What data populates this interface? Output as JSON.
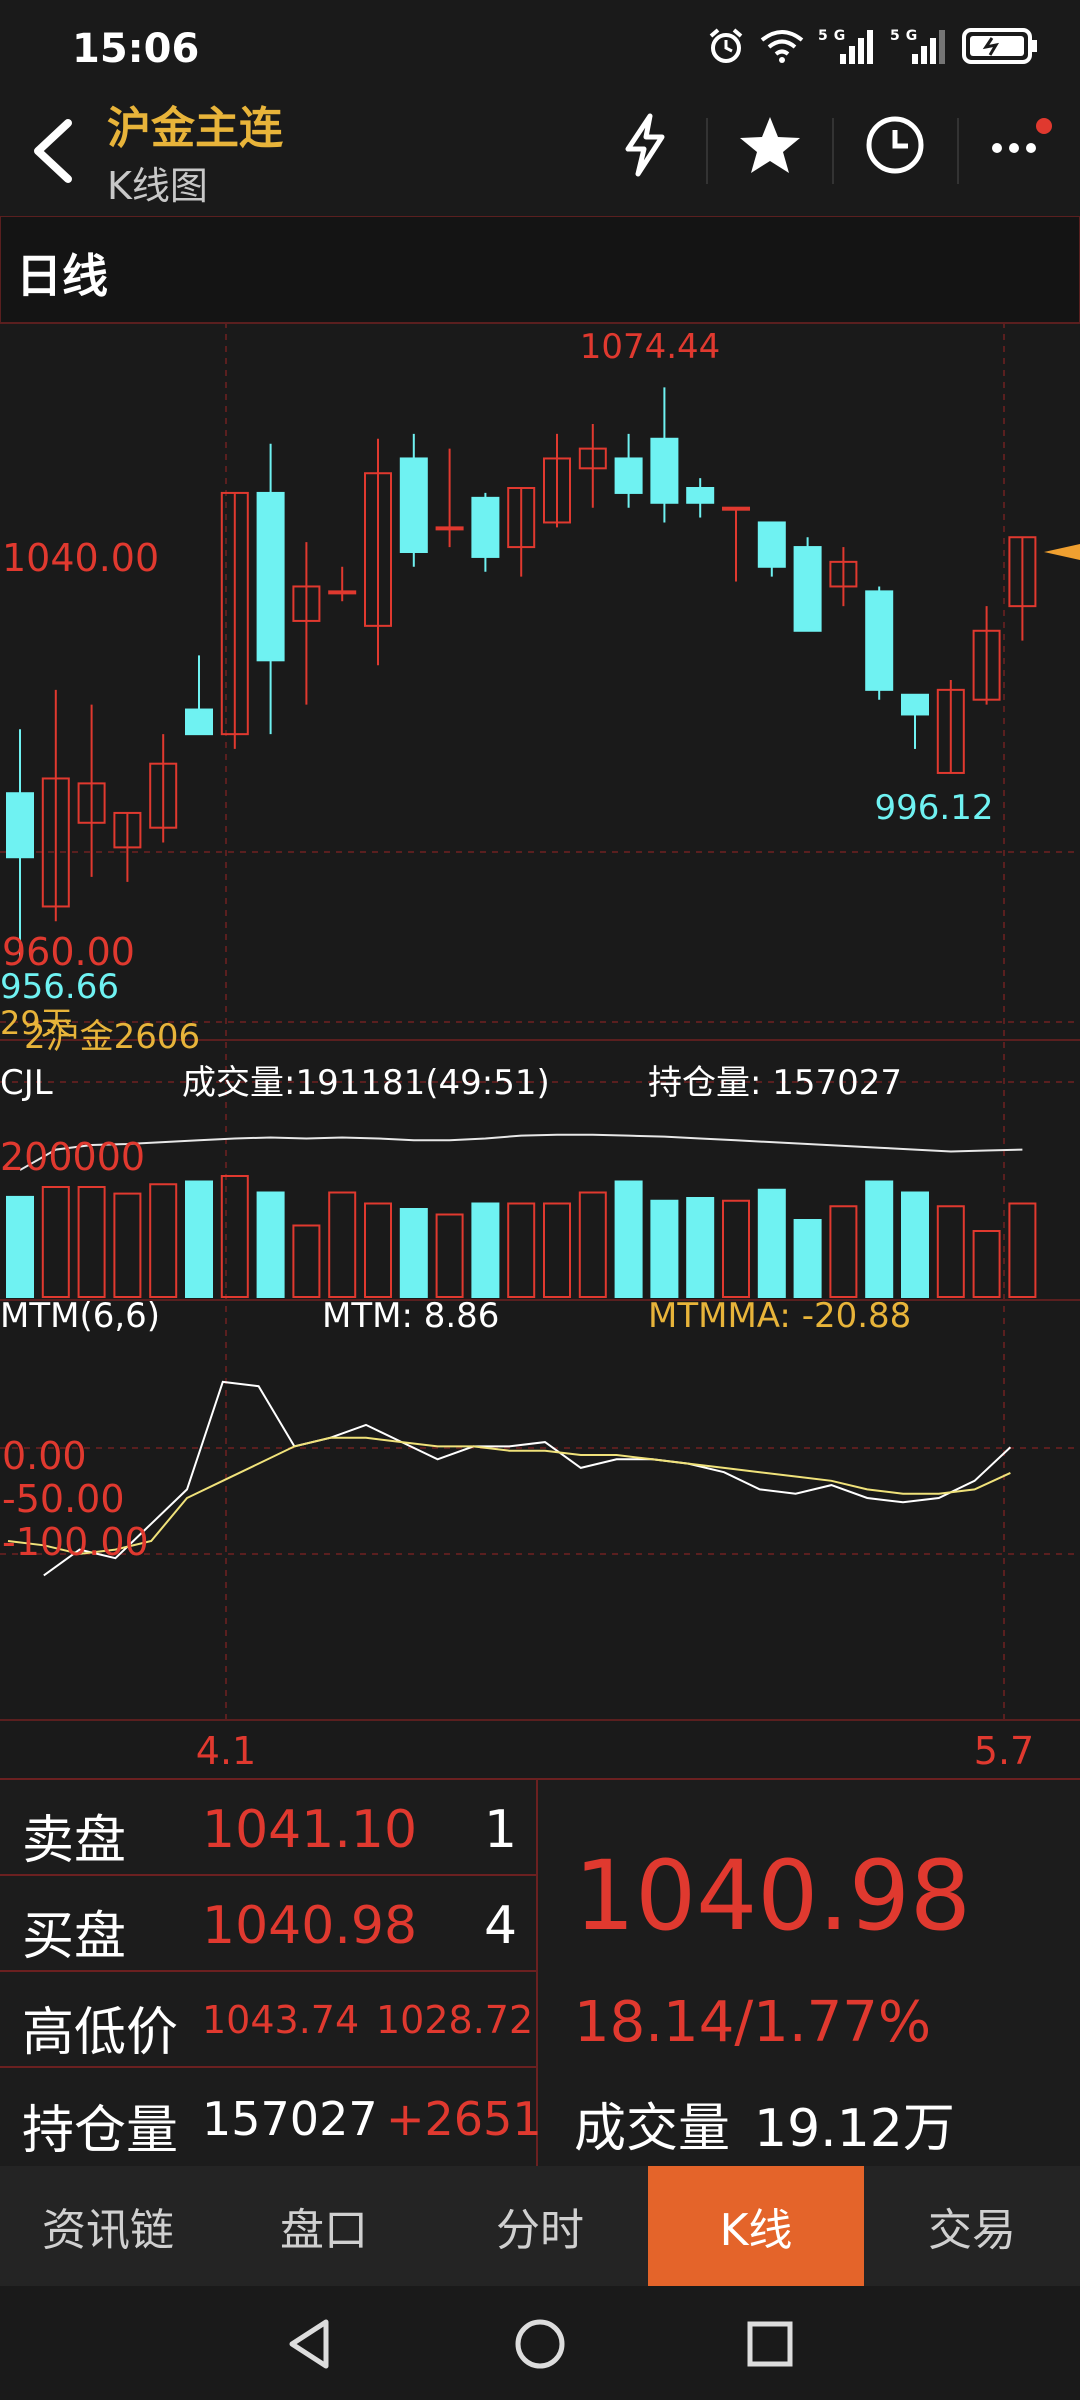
{
  "status": {
    "time": "15:06",
    "icons": [
      "alarm-icon",
      "wifi-icon",
      "5g-signal-icon",
      "5g-signal-icon",
      "battery-charging-icon"
    ]
  },
  "header": {
    "title": "沪金主连",
    "subtitle": "K线图",
    "actions": [
      "lightning-icon",
      "star-icon",
      "clock-icon",
      "more-icon"
    ]
  },
  "period": {
    "label": "日线"
  },
  "chart_data": {
    "type": "candlestick",
    "ylim": [
      950,
      1080
    ],
    "price_labels": [
      "1040.00",
      "960.00"
    ],
    "high_label": "1074.44",
    "low_label": "996.12",
    "left_low_label": "956.66",
    "contract_label": "2沪金2606",
    "contract_prefix": "29天",
    "x_ticks": [
      "4.1",
      "5.7"
    ],
    "candles": [
      {
        "o": 992,
        "h": 1005,
        "l": 958,
        "c": 979
      },
      {
        "o": 969,
        "h": 1013,
        "l": 966,
        "c": 995
      },
      {
        "o": 986,
        "h": 1010,
        "l": 975,
        "c": 994
      },
      {
        "o": 981,
        "h": 986,
        "l": 974,
        "c": 988
      },
      {
        "o": 985,
        "h": 1004,
        "l": 982,
        "c": 998
      },
      {
        "o": 1009,
        "h": 1020,
        "l": 1004,
        "c": 1004
      },
      {
        "o": 1004,
        "h": 1032,
        "l": 1001,
        "c": 1053
      },
      {
        "o": 1053,
        "h": 1063,
        "l": 1004,
        "c": 1019
      },
      {
        "o": 1027,
        "h": 1043,
        "l": 1010,
        "c": 1034
      },
      {
        "o": 1033,
        "h": 1038,
        "l": 1031,
        "c": 1033
      },
      {
        "o": 1026,
        "h": 1064,
        "l": 1018,
        "c": 1057
      },
      {
        "o": 1060,
        "h": 1065,
        "l": 1038,
        "c": 1041
      },
      {
        "o": 1046,
        "h": 1062,
        "l": 1042,
        "c": 1046
      },
      {
        "o": 1052,
        "h": 1053,
        "l": 1037,
        "c": 1040
      },
      {
        "o": 1042,
        "h": 1054,
        "l": 1036,
        "c": 1054
      },
      {
        "o": 1047,
        "h": 1065,
        "l": 1046,
        "c": 1060
      },
      {
        "o": 1058,
        "h": 1067,
        "l": 1050,
        "c": 1062
      },
      {
        "o": 1060,
        "h": 1065,
        "l": 1050,
        "c": 1053
      },
      {
        "o": 1064,
        "h": 1074.44,
        "l": 1047,
        "c": 1051
      },
      {
        "o": 1054,
        "h": 1056,
        "l": 1048,
        "c": 1051
      },
      {
        "o": 1050,
        "h": 1050,
        "l": 1035,
        "c": 1050
      },
      {
        "o": 1047,
        "h": 1047,
        "l": 1036,
        "c": 1038
      },
      {
        "o": 1042,
        "h": 1044,
        "l": 1025,
        "c": 1025
      },
      {
        "o": 1034,
        "h": 1042,
        "l": 1030,
        "c": 1039
      },
      {
        "o": 1033,
        "h": 1034,
        "l": 1011,
        "c": 1013
      },
      {
        "o": 1012,
        "h": 1011,
        "l": 1001,
        "c": 1008
      },
      {
        "o": 996.12,
        "h": 1015,
        "l": 996.12,
        "c": 1013
      },
      {
        "o": 1011,
        "h": 1030,
        "l": 1010,
        "c": 1025
      },
      {
        "o": 1030,
        "h": 1044,
        "l": 1023,
        "c": 1044
      }
    ],
    "volume": {
      "title": "CJL",
      "label": "成交量:191181(49:51)",
      "oi_label": "持仓量: 157027",
      "axis_label": "200000",
      "values": [
        182,
        200,
        200,
        188,
        205,
        210,
        220,
        190,
        130,
        190,
        170,
        160,
        150,
        170,
        170,
        170,
        190,
        210,
        175,
        180,
        175,
        195,
        140,
        165,
        210,
        190,
        165,
        120,
        170
      ],
      "oi_line": [
        158,
        180,
        185,
        186,
        188,
        190,
        192,
        193,
        192,
        193,
        192,
        190,
        190,
        192,
        195,
        196,
        196,
        195,
        194,
        192,
        190,
        188,
        186,
        184,
        182,
        180,
        178,
        179,
        180
      ]
    },
    "mtm": {
      "title": "MTM(6,6)",
      "mtm_label": "MTM: 8.86",
      "mtmma_label": "MTMMA: -20.88",
      "axis_labels": [
        "0.00",
        "-50.00",
        "-100.00"
      ],
      "mtm_values": [
        -140,
        -110,
        -120,
        -80,
        -40,
        85,
        80,
        10,
        20,
        35,
        15,
        -5,
        10,
        10,
        15,
        -15,
        -5,
        -5,
        -10,
        -20,
        -40,
        -45,
        -35,
        -50,
        -55,
        -50,
        -30,
        9
      ],
      "mtmma_values": [
        -100,
        -105,
        -115,
        -110,
        -100,
        -50,
        -30,
        -10,
        10,
        20,
        20,
        15,
        10,
        10,
        5,
        5,
        0,
        0,
        -5,
        -10,
        -15,
        -20,
        -25,
        -30,
        -40,
        -45,
        -45,
        -40,
        -20.88
      ]
    }
  },
  "quote": {
    "ask_label": "卖盘",
    "ask_price": "1041.10",
    "ask_qty": "1",
    "bid_label": "买盘",
    "bid_price": "1040.98",
    "bid_qty": "4",
    "hilo_label": "高低价",
    "high": "1043.74",
    "low": "1028.72",
    "oi_label": "持仓量",
    "oi_value": "157027",
    "oi_change": "+2651",
    "last_price": "1040.98",
    "change": "18.14/1.77%",
    "volume_label": "成交量",
    "volume_value": "19.12万"
  },
  "tabs": [
    {
      "label": "资讯链",
      "active": false
    },
    {
      "label": "盘口",
      "active": false
    },
    {
      "label": "分时",
      "active": false
    },
    {
      "label": "K线",
      "active": true
    },
    {
      "label": "交易",
      "active": false
    }
  ],
  "nav": [
    "back-nav-icon",
    "home-nav-icon",
    "recents-nav-icon"
  ],
  "colors": {
    "up": "#e0392f",
    "down": "#6ff2f2",
    "accent": "#e8b43a",
    "active_tab": "#e4642a",
    "grid": "#5a1f1f",
    "mtm_line": "#ffffff",
    "mtmma_line": "#f0e27a"
  }
}
